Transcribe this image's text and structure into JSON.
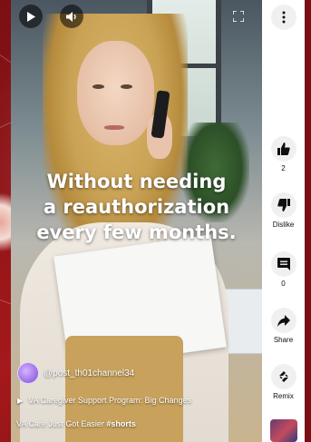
{
  "controls": {
    "play_icon": "play-icon",
    "volume_icon": "volume-icon",
    "fullscreen_icon": "fullscreen-icon",
    "more_icon": "more-vertical-icon"
  },
  "caption": {
    "line1": "Without needing",
    "line2": "a reauthorization",
    "line3": "every few months."
  },
  "channel": {
    "handle": "@post_th01channel34"
  },
  "playlist": {
    "label": "VA Caregiver Support Program: Big Changes"
  },
  "video": {
    "title": "VA Care Just Got Easier",
    "hashtag": "#shorts"
  },
  "actions": {
    "like_count": "2",
    "dislike_label": "Dislike",
    "comment_count": "0",
    "share_label": "Share",
    "remix_label": "Remix"
  },
  "colors": {
    "background": "#8e1414",
    "sidebar": "#ffffff"
  }
}
